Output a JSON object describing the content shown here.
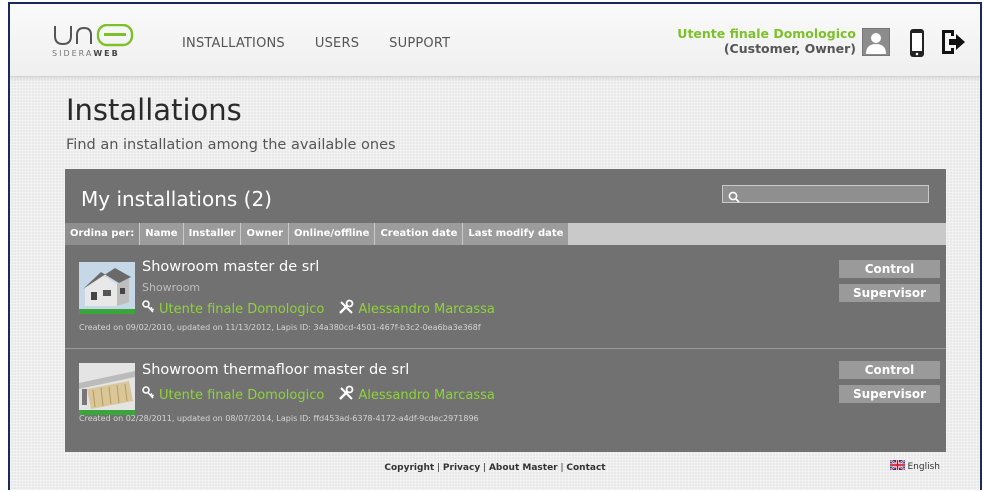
{
  "brand": {
    "logo_text": "UNA",
    "sub_prefix": "SIDERA",
    "sub_suffix": "WEB"
  },
  "nav": {
    "items": [
      "INSTALLATIONS",
      "USERS",
      "SUPPORT"
    ]
  },
  "user": {
    "name": "Utente finale Domologico",
    "role": "(Customer, Owner)"
  },
  "icons": {
    "avatar": "user-avatar-icon",
    "phone": "smartphone-icon",
    "logout": "logout-icon"
  },
  "page": {
    "title": "Installations",
    "subtitle": "Find an installation among the available ones"
  },
  "panel": {
    "title": "My installations (2)",
    "search_placeholder": "",
    "sort_label": "Ordina per:",
    "sort_options": [
      "Name",
      "Installer",
      "Owner",
      "Online/offline",
      "Creation date",
      "Last modify date"
    ]
  },
  "installations": [
    {
      "name": "Showroom master de srl",
      "type": "Showroom",
      "owner": "Utente finale Domologico",
      "installer": "Alessandro Marcassa",
      "meta": "Created on 09/02/2010, updated on 11/13/2012, Lapis ID: 34a380cd-4501-467f-b3c2-0ea6ba3e368f",
      "control_label": "Control",
      "supervisor_label": "Supervisor"
    },
    {
      "name": "Showroom thermafloor master de srl",
      "type": "",
      "owner": "Utente finale Domologico",
      "installer": "Alessandro Marcassa",
      "meta": "Created on 02/28/2011, updated on 08/07/2014, Lapis ID: ffd453ad-6378-4172-a4df-9cdec2971896",
      "control_label": "Control",
      "supervisor_label": "Supervisor"
    }
  ],
  "footer": {
    "links": [
      "Copyright",
      "Privacy",
      "About Master",
      "Contact"
    ],
    "language": "English"
  },
  "colors": {
    "accent_green": "#8fd33a",
    "panel_gray": "#717171",
    "button_gray": "#9a9a9a"
  }
}
